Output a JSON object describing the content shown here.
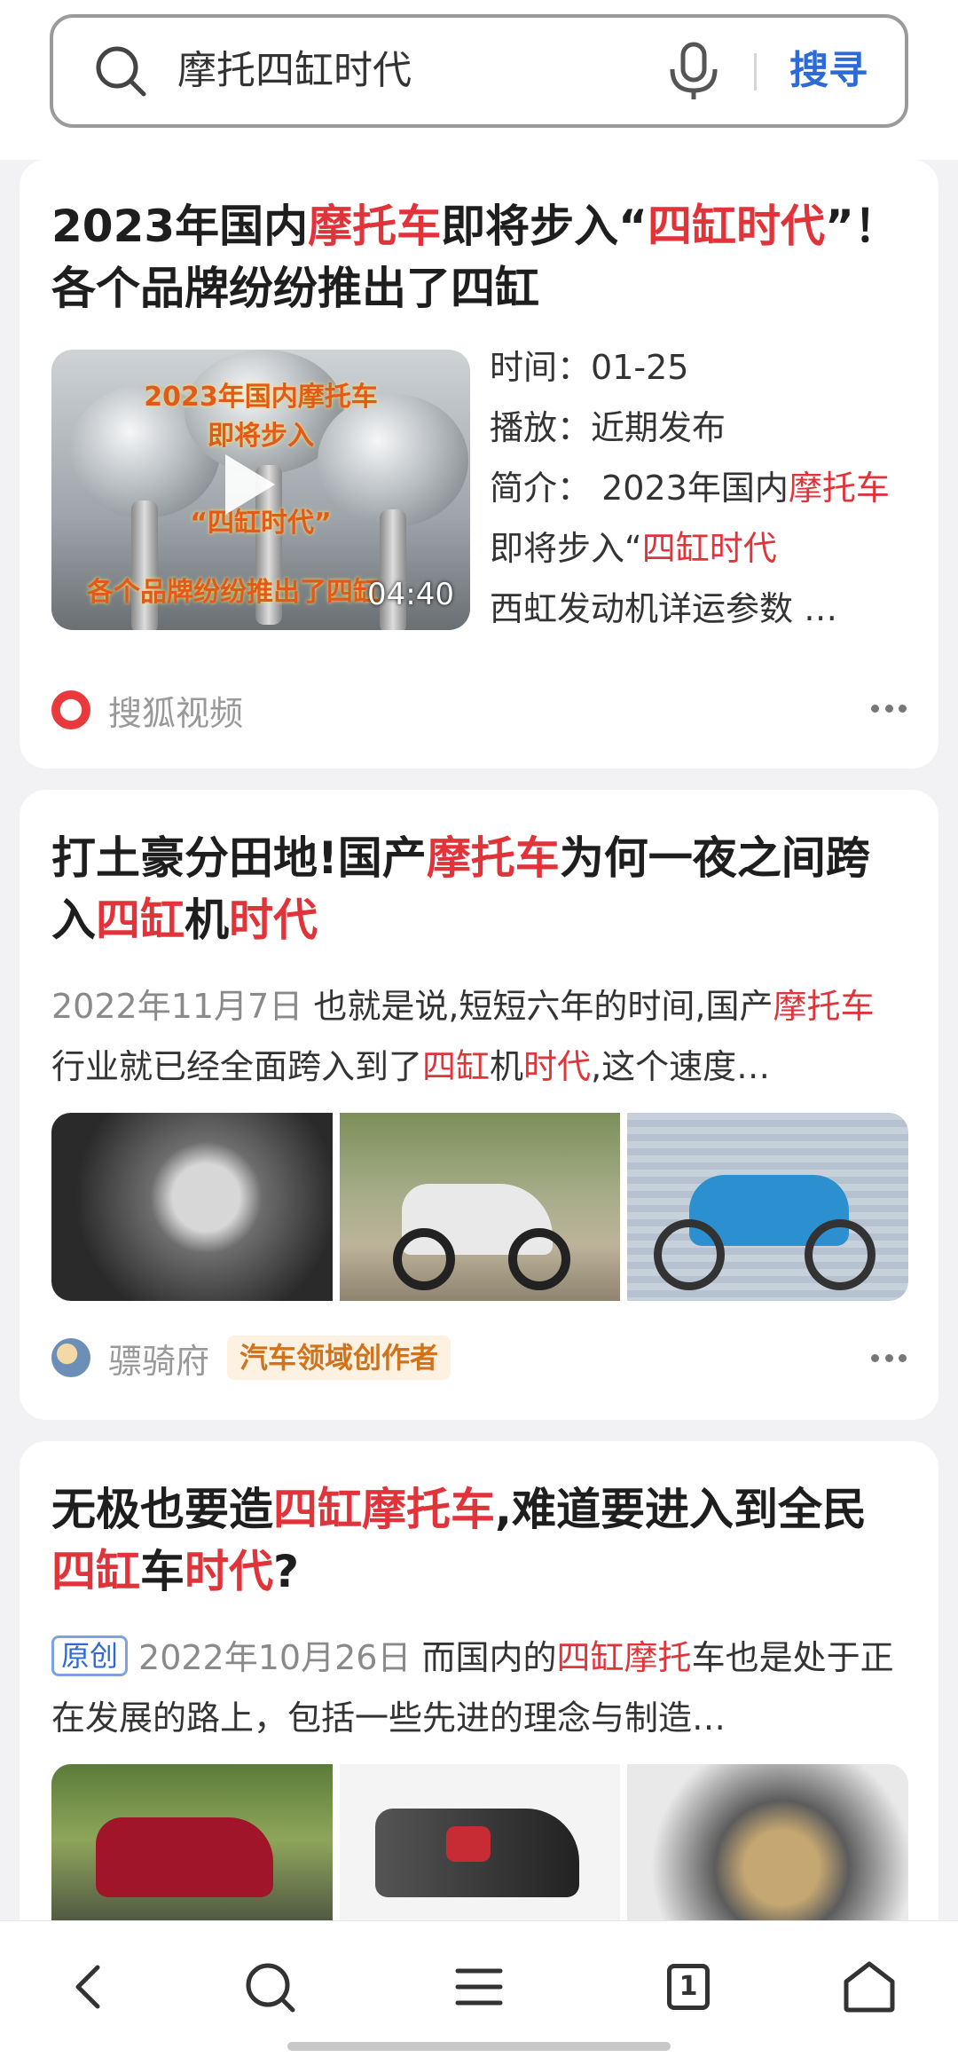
{
  "search": {
    "query": "摩托四缸时代",
    "submit_label": "搜寻"
  },
  "results": [
    {
      "title_parts": [
        "2023年国内",
        "摩托车",
        "即将步入“",
        "四缸时代",
        "”！ 各个品牌纷纷推出了四缸"
      ],
      "video": {
        "overlay_lines": [
          "2023年国内摩托车",
          "即将步入",
          "“四缸时代”",
          "各个品牌纷纷推出了四缸"
        ],
        "duration": "04:40"
      },
      "info": {
        "time_label": "时间：",
        "time_value": "01-25",
        "play_label": "播放：",
        "play_value": "近期发布",
        "desc_label": "简介：",
        "desc_parts": [
          "2023年国内",
          "摩托车",
          "即将步入“",
          "四缸时代"
        ],
        "desc_line3": "西虹发动机详运参数 …"
      },
      "source": "搜狐视频",
      "source_logo_text": "搜狐视频"
    },
    {
      "title_parts": [
        "打土豪分田地!国产",
        "摩托车",
        "为何一夜之间跨入",
        "四缸",
        "机",
        "时代"
      ],
      "date": "2022年11月7日",
      "snippet_parts": [
        "也就是说,短短六年的时间,国产",
        "摩托车",
        "行业就已经全面跨入到了",
        "四缸",
        "机",
        "时代",
        ",这个速度…"
      ],
      "source": "骠骑府",
      "badge": "汽车领域创作者"
    },
    {
      "title_parts": [
        "无极也要造",
        "四缸摩托车",
        ",难道要进入到全民",
        "四缸",
        "车",
        "时代",
        "?"
      ],
      "original_tag": "原创",
      "date": "2022年10月26日",
      "snippet_parts": [
        "而国内的",
        "四缸摩托",
        "车也是处于正在发展的路上，包括一些先进的理念与制造…"
      ]
    }
  ],
  "bottom_nav": {
    "tab_count": "1"
  },
  "icons": [
    "search-icon",
    "mic-icon",
    "more-icon",
    "back-icon",
    "search-nav-icon",
    "menu-icon",
    "tabs-icon",
    "home-icon",
    "play-icon"
  ]
}
